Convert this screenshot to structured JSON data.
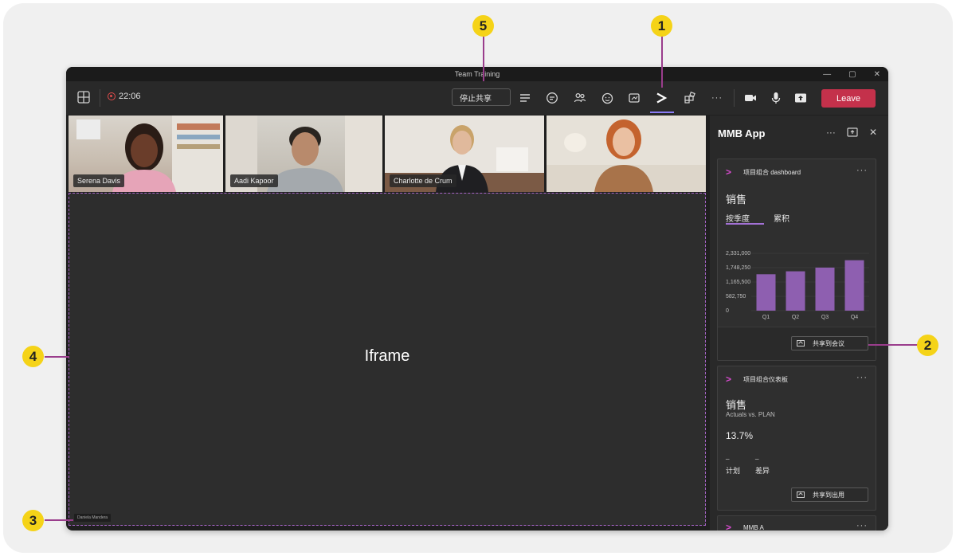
{
  "window": {
    "title": "Team Training",
    "controls": [
      "—",
      "▢",
      "✕"
    ]
  },
  "toolbar": {
    "recording_time": "22:06",
    "stop_share_label": "停止共享",
    "leave_label": "Leave",
    "more_label": "···"
  },
  "participants": [
    {
      "name": "Serena Davis"
    },
    {
      "name": "Aadi Kapoor"
    },
    {
      "name": "Charlotte de Crum"
    },
    {
      "name": ""
    }
  ],
  "stage": {
    "label": "Iframe",
    "presenter": "Daniela Mandera"
  },
  "panel": {
    "title": "MMB App",
    "more": "···",
    "close": "✕",
    "cards": [
      {
        "app_name": "项目组合 dashboard",
        "title": "销售",
        "tabs": [
          "按季度",
          "累积"
        ],
        "share_label": "共享到会议"
      },
      {
        "app_name": "项目组合仪表板",
        "title": "销售",
        "subtitle": "Actuals vs. PLAN",
        "value": "13.7%",
        "metric_labels": [
          "计划",
          "差异"
        ],
        "metric_values": [
          "_",
          "_"
        ],
        "share_label": "共享到出用"
      },
      {
        "app_name": "MMB A"
      }
    ]
  },
  "chart_data": {
    "type": "bar",
    "categories": [
      "Q1",
      "Q2",
      "Q3",
      "Q4"
    ],
    "values": [
      1480000,
      1600000,
      1750000,
      2050000
    ],
    "yticks": [
      "0",
      "582,750",
      "1,165,500",
      "1,748,250",
      "2,331,000"
    ],
    "ylim": [
      0,
      2331000
    ],
    "color": "#8e5fb0"
  },
  "callouts": [
    "1",
    "2",
    "3",
    "4",
    "5"
  ],
  "colors": {
    "leave": "#c4314b",
    "accent": "#8b7cf6",
    "callout": "#f5d318",
    "app_icon": "#d94bd0"
  }
}
